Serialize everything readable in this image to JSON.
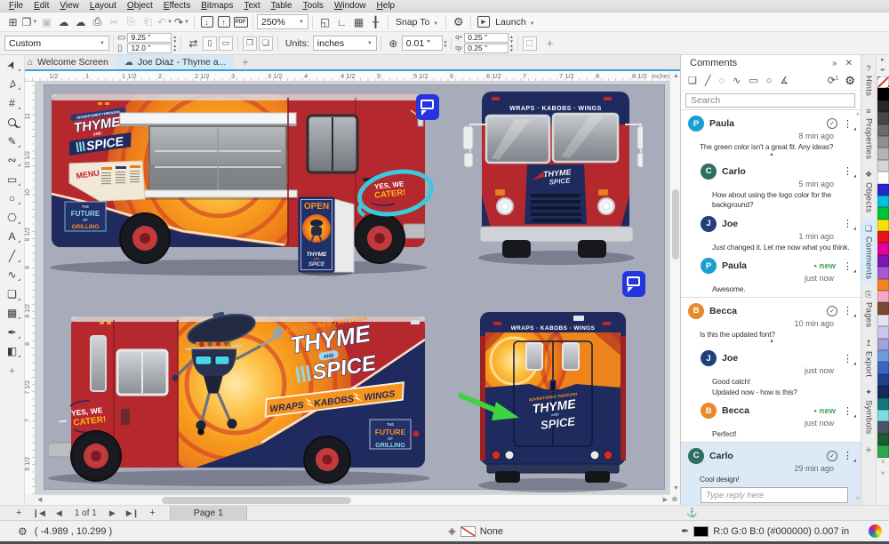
{
  "menu": {
    "items": [
      "File",
      "Edit",
      "View",
      "Layout",
      "Object",
      "Effects",
      "Bitmaps",
      "Text",
      "Table",
      "Tools",
      "Window",
      "Help"
    ]
  },
  "toolbar": {
    "icons_left": [
      {
        "name": "new-document-icon",
        "glyph": "⊞"
      },
      {
        "name": "open-folder-icon",
        "glyph": "❐",
        "dropdown": true
      },
      {
        "name": "save-icon",
        "glyph": "▣",
        "disabled": true
      },
      {
        "name": "cloud-download-icon",
        "glyph": "☁"
      },
      {
        "name": "cloud-upload-icon",
        "glyph": "☁"
      },
      {
        "name": "print-icon",
        "glyph": "⎙"
      },
      {
        "name": "cut-icon",
        "glyph": "✂",
        "disabled": true
      },
      {
        "name": "copy-icon",
        "glyph": "⎘",
        "disabled": true
      },
      {
        "name": "paste-icon",
        "glyph": "⎗",
        "disabled": true
      },
      {
        "name": "undo-icon",
        "glyph": "↶",
        "dropdown": true,
        "disabled": true
      },
      {
        "name": "redo-icon",
        "glyph": "↷",
        "dropdown": true
      }
    ],
    "import_glyph": "↓",
    "export_glyph": "↑",
    "pdf_label": "PDF",
    "zoom_level": "250%",
    "icons_mid": [
      {
        "name": "fullscreen-preview-icon",
        "glyph": "◱"
      },
      {
        "name": "show-rulers-icon",
        "glyph": "∟"
      },
      {
        "name": "show-grid-icon",
        "glyph": "▦"
      },
      {
        "name": "show-guidelines-icon",
        "glyph": "╂"
      }
    ],
    "snap_label": "Snap To",
    "options_icon": "⚙",
    "launch_label": "Launch",
    "launch_glyph": "▸"
  },
  "property_bar": {
    "preset": "Custom",
    "page_width": "9.25 \"",
    "page_height": "12.0 \"",
    "units_label": "Units:",
    "units_value": "inches",
    "nudge_value": "0.01 \"",
    "dup_x": "0.25 \"",
    "dup_y": "0.25 \"",
    "plus": "+"
  },
  "doc_tabs": {
    "home_tab": "Welcome Screen",
    "doc_tab": "Joe Diaz - Thyme a...",
    "new_tab": "+"
  },
  "toolbox": {
    "tools": [
      {
        "name": "pick-tool",
        "glyph": "➤"
      },
      {
        "name": "shape-tool",
        "glyph": "⊿"
      },
      {
        "name": "crop-tool",
        "glyph": "#"
      },
      {
        "name": "zoom-tool",
        "glyph": "Q"
      },
      {
        "name": "freehand-tool",
        "glyph": "✎"
      },
      {
        "name": "artistic-media-tool",
        "glyph": "∾"
      },
      {
        "name": "rectangle-tool",
        "glyph": "▭"
      },
      {
        "name": "ellipse-tool",
        "glyph": "○"
      },
      {
        "name": "polygon-tool",
        "glyph": "⎔"
      },
      {
        "name": "text-tool",
        "glyph": "A"
      },
      {
        "name": "dimension-tool",
        "glyph": "╱"
      },
      {
        "name": "connector-tool",
        "glyph": "∿"
      },
      {
        "name": "drop-shadow-tool",
        "glyph": "❏"
      },
      {
        "name": "transparency-tool",
        "glyph": "▦"
      },
      {
        "name": "eyedropper-tool",
        "glyph": "✒"
      },
      {
        "name": "interactive-fill-tool",
        "glyph": "◧"
      },
      {
        "name": "more-tools",
        "glyph": "+"
      }
    ]
  },
  "rulers": {
    "units": "inches",
    "h_labels": [
      {
        "t": "1/2",
        "p": 27
      },
      {
        "t": "1",
        "p": 68
      },
      {
        "t": "1 1/2",
        "p": 109
      },
      {
        "t": "2",
        "p": 150
      },
      {
        "t": "2 1/2",
        "p": 191
      },
      {
        "t": "3",
        "p": 232
      },
      {
        "t": "3 1/2",
        "p": 273
      },
      {
        "t": "4",
        "p": 314
      },
      {
        "t": "4 1/2",
        "p": 355
      },
      {
        "t": "5",
        "p": 396
      },
      {
        "t": "5 1/2",
        "p": 437
      },
      {
        "t": "6",
        "p": 478
      },
      {
        "t": "6 1/2",
        "p": 519
      },
      {
        "t": "7",
        "p": 560
      },
      {
        "t": "7 1/2",
        "p": 601
      },
      {
        "t": "8",
        "p": 642
      },
      {
        "t": "8 1/2",
        "p": 683
      }
    ],
    "v_labels": [
      {
        "t": "11",
        "p": 35
      },
      {
        "t": "10 1/2",
        "p": 78
      },
      {
        "t": "10",
        "p": 121
      },
      {
        "t": "9 1/2",
        "p": 164
      },
      {
        "t": "9",
        "p": 207
      },
      {
        "t": "8 1/2",
        "p": 250
      },
      {
        "t": "8",
        "p": 293
      },
      {
        "t": "7 1/2",
        "p": 336
      },
      {
        "t": "7",
        "p": 379
      },
      {
        "t": "6 1/2",
        "p": 422
      }
    ]
  },
  "canvas": {
    "design": {
      "brand_small": "ADVENTURES THROUGH",
      "brand_thyme": "THYME",
      "brand_and": "AND",
      "brand_spice": "SPICE",
      "banner_w1": "WRAPS",
      "banner_w2": "KABOBS",
      "banner_w3": "WINGS",
      "front_banner": "WRAPS · KABOBS · WINGS",
      "cater_1": "YES, WE",
      "cater_2": "CATER!",
      "open_sign": "OPEN",
      "menu_board": "MENU",
      "future_1": "THE",
      "future_2": "FUTURE",
      "future_3": "OF",
      "future_4": "GRILLING"
    }
  },
  "comments": {
    "title": "Comments",
    "search_placeholder": "Search",
    "new_label": "• new",
    "reply_placeholder": "Type reply here",
    "tools": [
      {
        "name": "note-comment-icon",
        "glyph": "❑"
      },
      {
        "name": "pen-annotation-icon",
        "glyph": "╱"
      },
      {
        "name": "lasso-annotation-icon",
        "glyph": "◌"
      },
      {
        "name": "freehand-annotation-icon",
        "glyph": "∿"
      },
      {
        "name": "rectangle-annotation-icon",
        "glyph": "▭"
      },
      {
        "name": "ellipse-annotation-icon",
        "glyph": "○"
      },
      {
        "name": "arrow-annotation-icon",
        "glyph": "∡"
      }
    ],
    "items": [
      {
        "initial": "P",
        "color": "#1b9ed2",
        "name": "Paula",
        "time": "8 min ago",
        "text": "The green color isn't a great fit. Any ideas?",
        "resolved": true,
        "caret": true,
        "top": true
      },
      {
        "initial": "C",
        "color": "#2e6f63",
        "name": "Carlo",
        "time": "5 min ago",
        "text": "How about using the logo color for the background?",
        "reply": true
      },
      {
        "initial": "J",
        "color": "#20407c",
        "name": "Joe",
        "time": "1 min ago",
        "text": "Just changed it. Let me now what you think.",
        "reply": true
      },
      {
        "initial": "P",
        "color": "#1b9ed2",
        "name": "Paula",
        "time": "just now",
        "text": "Awesome.",
        "reply": true,
        "isnew": true
      },
      {
        "initial": "B",
        "color": "#e8892d",
        "name": "Becca",
        "time": "10 min ago",
        "text": "Is this the updated font?",
        "resolved": true,
        "caret": true,
        "top": true
      },
      {
        "initial": "J",
        "color": "#20407c",
        "name": "Joe",
        "time": "just now",
        "text": "Good catch!\nUpdated now - how is this?",
        "reply": true
      },
      {
        "initial": "B",
        "color": "#e8892d",
        "name": "Becca",
        "time": "just now",
        "text": "Perfect!",
        "reply": true,
        "isnew": true
      },
      {
        "initial": "C",
        "color": "#2e6f63",
        "name": "Carlo",
        "time": "29 min ago",
        "text": "Cool design!",
        "resolved": true,
        "top": true,
        "highlight": true,
        "reply_input": true
      }
    ]
  },
  "dockers": {
    "tabs": [
      {
        "label": "Hints",
        "icon": "?"
      },
      {
        "label": "Properties",
        "icon": "≡"
      },
      {
        "label": "Objects",
        "icon": "❖"
      },
      {
        "label": "Comments",
        "icon": "❏",
        "active": true
      },
      {
        "label": "Pages",
        "icon": "⎘"
      },
      {
        "label": "Export",
        "icon": "↥"
      },
      {
        "label": "Symbols",
        "icon": "✦"
      }
    ],
    "more": "+"
  },
  "palette": {
    "colors": [
      "#000000",
      "#262626",
      "#474747",
      "#6b6b6b",
      "#8f8f8f",
      "#b3b3b3",
      "#d6d6d6",
      "#ffffff",
      "#2626cf",
      "#00c0dd",
      "#00c437",
      "#f5e400",
      "#e81416",
      "#e4009f",
      "#7d14b8",
      "#a55ad2",
      "#f58220",
      "#f7a8c4",
      "#7a4b32",
      "#e3e3f2",
      "#c9c9ea",
      "#a3a3dc",
      "#6f9bdc",
      "#3a66c4",
      "#24418f",
      "#16295c",
      "#127a7a",
      "#7adce8",
      "#46556a",
      "#1c5c30",
      "#2ea84f"
    ]
  },
  "doc_nav": {
    "add": "+",
    "first": "❙◀",
    "prev": "◀",
    "page_info": "1 of 1",
    "next": "▶",
    "last": "▶❙",
    "add2": "+",
    "page_tab": "Page 1"
  },
  "status": {
    "coords": "( -4.989 , 10.299 )",
    "fill_label": "None",
    "outline_text": "R:0 G:0 B:0 (#000000)  0.007 in"
  }
}
